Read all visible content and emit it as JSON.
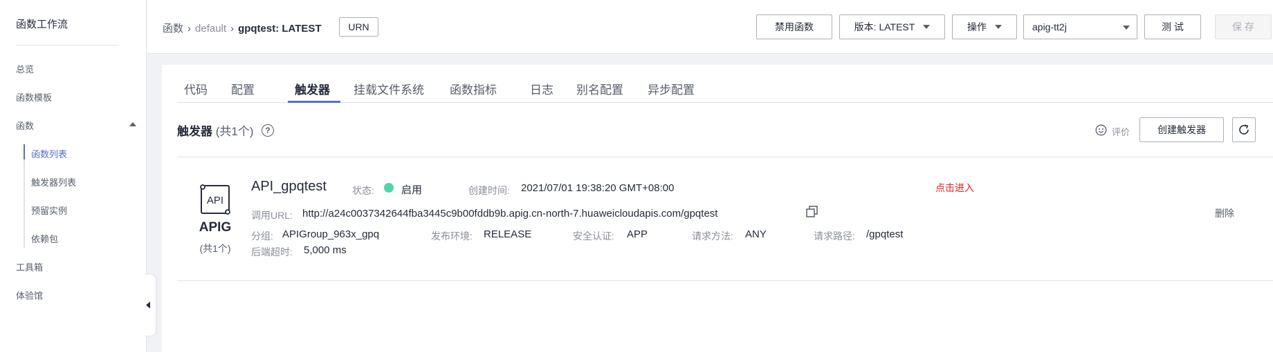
{
  "sidebar": {
    "title": "函数工作流",
    "items": [
      {
        "label": "总览"
      },
      {
        "label": "函数模板"
      },
      {
        "label": "函数"
      },
      {
        "label": "工具箱"
      },
      {
        "label": "体验馆"
      }
    ],
    "sub_items": [
      {
        "label": "函数列表",
        "active": true
      },
      {
        "label": "触发器列表"
      },
      {
        "label": "预留实例"
      },
      {
        "label": "依赖包"
      }
    ]
  },
  "header": {
    "breadcrumb": {
      "root": "函数",
      "app": "default",
      "current": "gpqtest: LATEST"
    },
    "urn_label": "URN",
    "disable_label": "禁用函数",
    "version_label": "版本: LATEST",
    "operations_label": "操作",
    "apig_select": "apig-tt2j",
    "test_label": "测 试",
    "save_label": "保 存"
  },
  "tabs": [
    {
      "label": "代码"
    },
    {
      "label": "配置"
    },
    {
      "label": "触发器",
      "active": true
    },
    {
      "label": "挂载文件系统"
    },
    {
      "label": "函数指标"
    },
    {
      "label": "日志"
    },
    {
      "label": "别名配置"
    },
    {
      "label": "异步配置"
    }
  ],
  "triggers_panel": {
    "title": "触发器",
    "count": "(共1个)",
    "rate_label": "评价",
    "create_label": "创建触发器"
  },
  "trigger": {
    "type_label": "APIG",
    "type_count": "(共1个)",
    "name": "API_gpqtest",
    "status_label": "状态:",
    "status_value": "启用",
    "status_color": "#50d4ab",
    "created_label": "创建时间:",
    "created_value": "2021/07/01 19:38:20 GMT+08:00",
    "enter_label": "点击进入",
    "url_label": "调用URL:",
    "url_value": "http://a24c0037342644fba3445c9b00fddb9b.apig.cn-north-7.huaweicloudapis.com/gpqtest",
    "group_label": "分组:",
    "group_value": "APIGroup_963x_gpq",
    "env_label": "发布环境:",
    "env_value": "RELEASE",
    "auth_label": "安全认证:",
    "auth_value": "APP",
    "method_label": "请求方法:",
    "method_value": "ANY",
    "path_label": "请求路径:",
    "path_value": "/gpqtest",
    "timeout_label": "后端超时:",
    "timeout_value": "5,000 ms",
    "delete_label": "删除"
  },
  "colors": {
    "accent": "#526ecc",
    "enter_link": "#e02020"
  }
}
